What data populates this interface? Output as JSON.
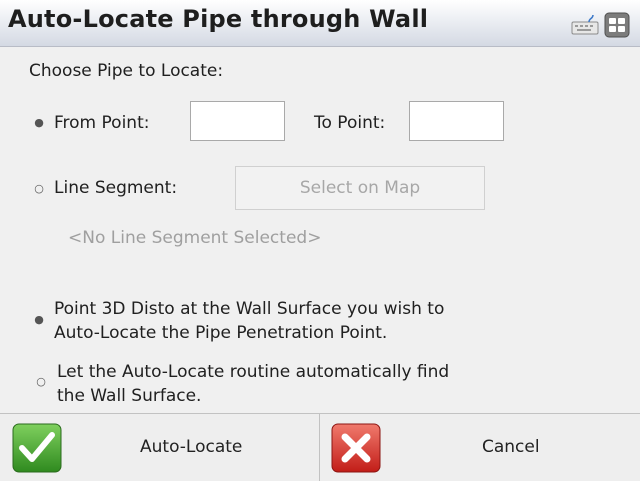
{
  "window": {
    "title": "Auto-Locate Pipe through Wall"
  },
  "toolbar": {
    "keyboard_icon": "keyboard-icon",
    "menu_icon": "menu-icon"
  },
  "form": {
    "section_label": "Choose Pipe to Locate:",
    "from_point": {
      "label": "From Point:",
      "selected": true,
      "value": ""
    },
    "to_point": {
      "label": "To Point:",
      "value": ""
    },
    "line_segment": {
      "label": "Line Segment:",
      "selected": false
    },
    "select_on_map_label": "Select on Map",
    "no_segment_text": "<No Line Segment Selected>",
    "option_disto": {
      "line1": "Point 3D Disto at the Wall Surface you wish to",
      "line2": "Auto-Locate the Pipe Penetration Point.",
      "selected": true
    },
    "option_auto": {
      "line1": "Let the Auto-Locate routine automatically find",
      "line2": "the Wall Surface.",
      "selected": false
    }
  },
  "footer": {
    "auto_locate_label": "Auto-Locate",
    "cancel_label": "Cancel",
    "ok_icon": "checkmark-icon",
    "cancel_icon": "x-icon",
    "colors": {
      "check": "#3f9c2b",
      "cancel": "#d42a24"
    }
  }
}
